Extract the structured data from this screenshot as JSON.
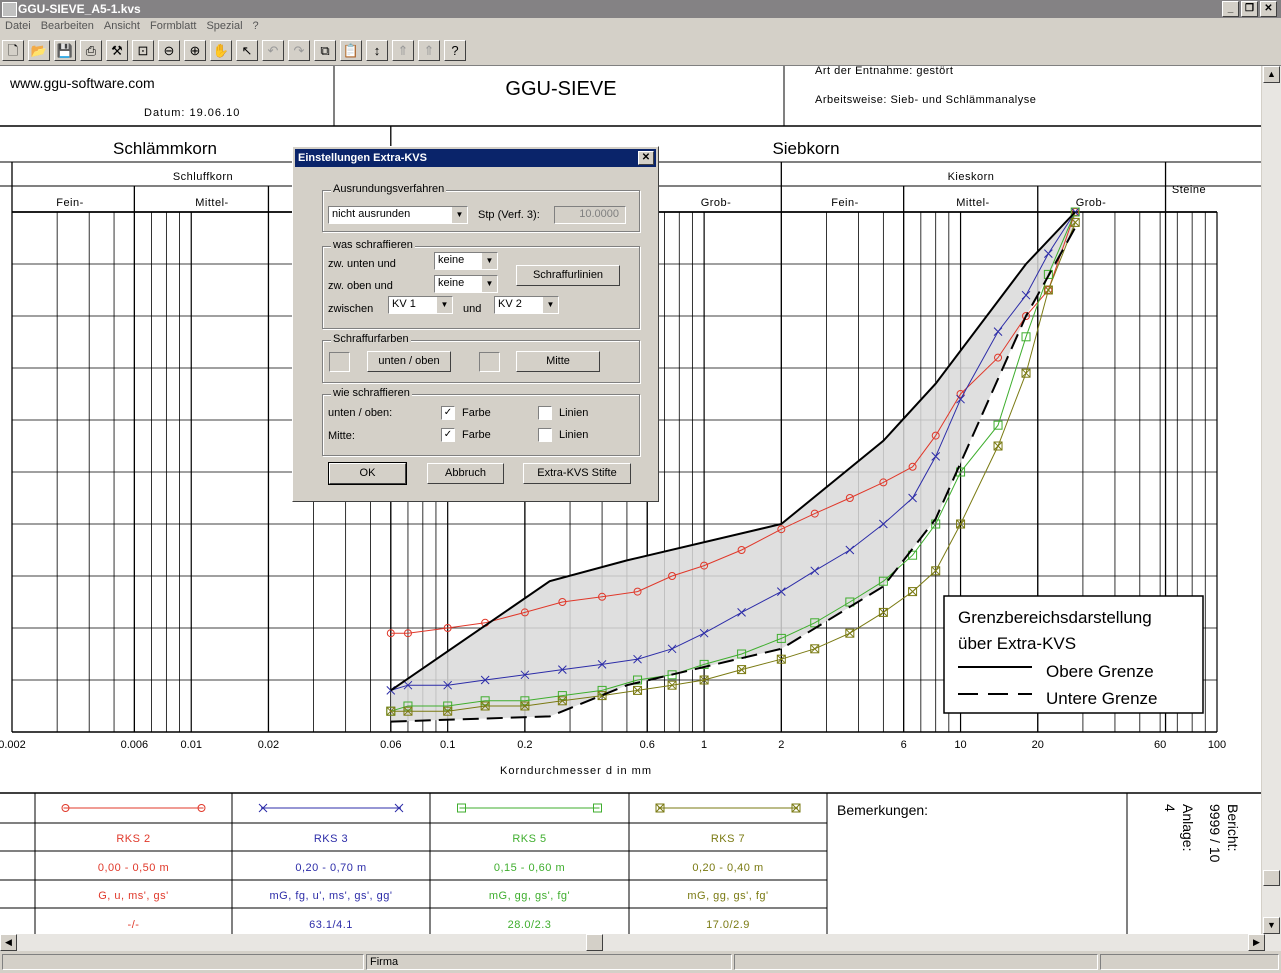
{
  "window": {
    "title": "GGU-SIEVE_A5-1.kvs"
  },
  "menu": [
    "Datei",
    "Bearbeiten",
    "Ansicht",
    "Formblatt",
    "Spezial",
    "?"
  ],
  "toolbar_icons": [
    "new-icon",
    "open-icon",
    "save-icon",
    "print-icon",
    "tool-icon",
    "zoom-page-icon",
    "zoom-out-icon",
    "zoom-in-icon",
    "pan-icon",
    "pointer-icon",
    "undo-icon",
    "redo-icon",
    "copy-icon",
    "paste-icon",
    "move-updown-icon",
    "arrow-up-icon",
    "arrow-up-icon",
    "help-icon"
  ],
  "header": {
    "website": "www.ggu-software.com",
    "datum": "Datum:  19.06.10",
    "program": "GGU-SIEVE",
    "entnahme": "Art der Entnahme:  gestört",
    "arbeitsweise": "Arbeitsweise:  Sieb- und Schlämmanalyse"
  },
  "chart": {
    "left_heading": "Schlämmkorn",
    "right_heading": "Siebkorn",
    "schluff": "Schluffkorn",
    "kies": "Kieskorn",
    "steine": "Steine",
    "subs": [
      "Fein-",
      "Mittel-",
      "Grob-",
      "Fein-",
      "Mittel-",
      "Grob-"
    ],
    "xlabel": "Korndurchmesser d in mm",
    "tick_labels": [
      "0.002",
      "0.006",
      "0.01",
      "0.02",
      "0.06",
      "0.1",
      "0.2",
      "0.6",
      "1",
      "2",
      "6",
      "10",
      "20",
      "60",
      "100"
    ],
    "legend_box": {
      "title1": "Grenzbereichsdarstellung",
      "title2": "über Extra-KVS",
      "upper": "Obere Grenze",
      "lower": "Untere Grenze"
    }
  },
  "chart_data": {
    "type": "line",
    "x_scale": "log",
    "xlim": [
      0.002,
      100
    ],
    "ylim": [
      0,
      100
    ],
    "xlabel": "Korndurchmesser d in mm",
    "series": [
      {
        "name": "RKS 2",
        "color": "#e0382a",
        "marker": "circle",
        "x": [
          0.06,
          0.07,
          0.1,
          0.14,
          0.2,
          0.28,
          0.4,
          0.55,
          0.75,
          1,
          1.4,
          2,
          2.7,
          3.7,
          5,
          6.5,
          8,
          10,
          14,
          18,
          22,
          28
        ],
        "y": [
          19,
          19,
          20,
          21,
          23,
          25,
          26,
          27,
          30,
          32,
          35,
          39,
          42,
          45,
          48,
          51,
          57,
          65,
          72,
          80,
          85,
          100
        ]
      },
      {
        "name": "RKS 3",
        "color": "#2c2ca8",
        "marker": "x",
        "x": [
          0.06,
          0.07,
          0.1,
          0.14,
          0.2,
          0.28,
          0.4,
          0.55,
          0.75,
          1,
          1.4,
          2,
          2.7,
          3.7,
          5,
          6.5,
          8,
          10,
          14,
          18,
          22,
          28
        ],
        "y": [
          8,
          9,
          9,
          10,
          11,
          12,
          13,
          14,
          16,
          19,
          23,
          27,
          31,
          35,
          40,
          45,
          53,
          64,
          77,
          84,
          92,
          100
        ]
      },
      {
        "name": "RKS 5",
        "color": "#3fae2e",
        "marker": "square",
        "x": [
          0.06,
          0.07,
          0.1,
          0.14,
          0.2,
          0.28,
          0.4,
          0.55,
          0.75,
          1,
          1.4,
          2,
          2.7,
          3.7,
          5,
          6.5,
          8,
          10,
          14,
          18,
          22,
          28
        ],
        "y": [
          4,
          5,
          5,
          6,
          6,
          7,
          8,
          10,
          11,
          13,
          15,
          18,
          21,
          25,
          29,
          34,
          40,
          50,
          59,
          76,
          88,
          100
        ]
      },
      {
        "name": "RKS 7",
        "color": "#7a7a12",
        "marker": "square-x",
        "x": [
          0.06,
          0.07,
          0.1,
          0.14,
          0.2,
          0.28,
          0.4,
          0.55,
          0.75,
          1,
          1.4,
          2,
          2.7,
          3.7,
          5,
          6.5,
          8,
          10,
          14,
          18,
          22,
          28
        ],
        "y": [
          4,
          4,
          4,
          5,
          5,
          6,
          7,
          8,
          9,
          10,
          12,
          14,
          16,
          19,
          23,
          27,
          31,
          40,
          55,
          69,
          85,
          98
        ]
      },
      {
        "name": "Obere Grenze",
        "color": "#000000",
        "style": "solid",
        "x": [
          0.06,
          0.25,
          0.5,
          2,
          5,
          8,
          18,
          28
        ],
        "y": [
          8,
          29,
          33,
          40,
          56,
          67,
          90,
          100
        ]
      },
      {
        "name": "Untere Grenze",
        "color": "#000000",
        "style": "dashed",
        "x": [
          0.06,
          0.25,
          0.5,
          2,
          5,
          8,
          18,
          28
        ],
        "y": [
          2,
          3,
          9,
          16,
          28,
          41,
          80,
          97
        ]
      }
    ]
  },
  "table": {
    "rows": [
      [
        "RKS 2",
        "RKS 3",
        "RKS 5",
        "RKS 7"
      ],
      [
        "0,00 - 0,50 m",
        "0,20 - 0,70 m",
        "0,15 - 0,60 m",
        "0,20 - 0,40 m"
      ],
      [
        "G, u, ms', gs'",
        "mG, fg, u', ms', gs', gg'",
        "mG, gg, gs', fg'",
        "mG, gg, gs', fg'"
      ],
      [
        "-/-",
        "63.1/4.1",
        "28.0/2.3",
        "17.0/2.9"
      ]
    ],
    "colors": [
      "#e0382a",
      "#2c2ca8",
      "#3fae2e",
      "#7a7a12"
    ],
    "bemerkungen": "Bemerkungen:",
    "bericht": "Bericht:",
    "bericht_nr": "9999 / 10",
    "anlage": "Anlage:",
    "anlage_nr": "4"
  },
  "dialog": {
    "title": "Einstellungen Extra-KVS",
    "group1": "Ausrundungsverfahren",
    "rounding": "nicht ausrunden",
    "stp_label": "Stp (Verf. 3):",
    "stp_value": "10.0000",
    "group2": "was schraffieren",
    "zw_unten": "zw. unten und",
    "zw_unten_val": "keine",
    "zw_oben": "zw. oben und",
    "zw_oben_val": "keine",
    "zwischen": "zwischen",
    "kv1": "KV 1",
    "und": "und",
    "kv2": "KV 2",
    "schraffurlinien": "Schraffurlinien",
    "group3": "Schraffurfarben",
    "unten_oben_btn": "unten / oben",
    "mitte_btn": "Mitte",
    "group4": "wie schraffieren",
    "row1": "unten / oben:",
    "row2": "Mitte:",
    "farbe": "Farbe",
    "linien": "Linien",
    "ok": "OK",
    "abbruch": "Abbruch",
    "stifte": "Extra-KVS Stifte"
  },
  "status": {
    "panel2": "Firma"
  }
}
